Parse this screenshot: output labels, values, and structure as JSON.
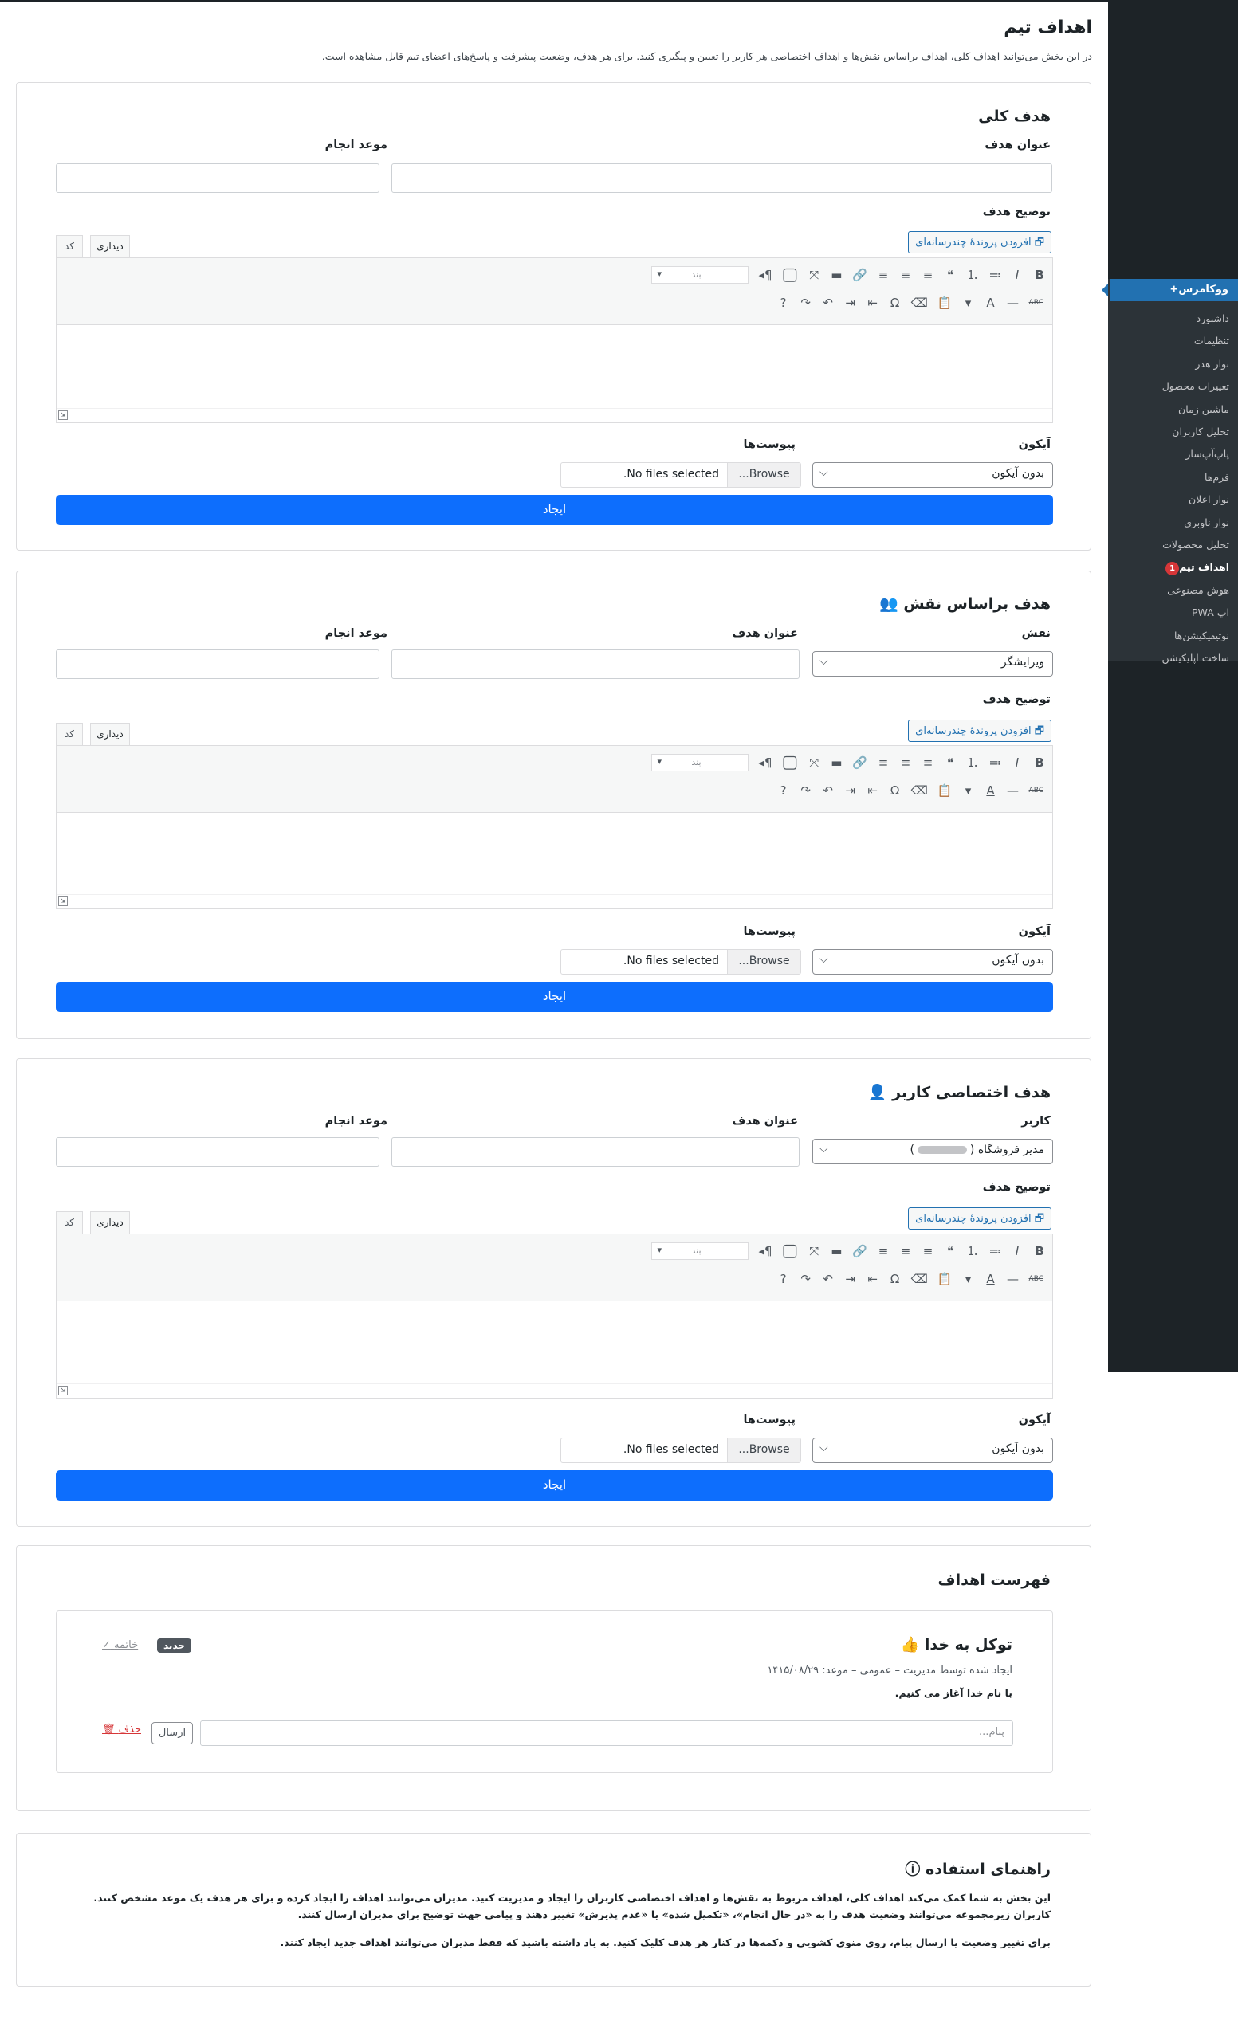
{
  "page": {
    "title": "اهداف تیم",
    "description": "در این بخش می‌توانید اهداف کلی، اهداف براساس نقش‌ها و اهداف اختصاصی هر کاربر را تعیین و پیگیری کنید. برای هر هدف، وضعیت پیشرفت و پاسخ‌های اعضای تیم قابل مشاهده است."
  },
  "sidebar": {
    "menu_title": "ووکامرس+",
    "items": [
      {
        "label": "داشبورد"
      },
      {
        "label": "تنظیمات"
      },
      {
        "label": "نوار هدر"
      },
      {
        "label": "تغییرات محصول"
      },
      {
        "label": "ماشین زمان"
      },
      {
        "label": "تحلیل کاربران"
      },
      {
        "label": "پاپ‌آپ‌ساز"
      },
      {
        "label": "فرم‌ها"
      },
      {
        "label": "نوار اعلان"
      },
      {
        "label": "نوار ناوبری"
      },
      {
        "label": "تحلیل محصولات"
      },
      {
        "label": "اهداف تیم",
        "badge": "1",
        "current": true
      },
      {
        "label": "هوش مصنوعی"
      },
      {
        "label": "اپ PWA"
      },
      {
        "label": "نوتیفیکیشن‌ها"
      },
      {
        "label": "ساخت اپلیکیشن"
      }
    ]
  },
  "editor": {
    "add_media": "افزودن پروندهٔ چندرسانه‌ای",
    "tab_visual": "دیداری",
    "tab_code": "کد",
    "format_placeholder": "بند",
    "row1_icons": [
      "B",
      "I",
      "≔",
      "⒈",
      "❝",
      "≡",
      "≡",
      "≡",
      "🔗",
      "▬",
      "⤧",
      "▢",
      "¶◂"
    ],
    "row2_icons": [
      "ABC",
      "—",
      "A",
      "▾",
      "📋",
      "⌫",
      "Ω",
      "⇤",
      "⇥",
      "↶",
      "↷",
      "?"
    ]
  },
  "general_goal": {
    "heading": "هدف کلی",
    "title_label": "عنوان هدف",
    "deadline_label": "موعد انجام",
    "description_label": "توضیح هدف",
    "icon_label": "آیکون",
    "icon_value": "بدون آیکون",
    "attachments_label": "پیوست‌ها",
    "browse_label": "Browse...",
    "no_files": "No files selected.",
    "create_label": "ایجاد"
  },
  "role_goal": {
    "heading": "هدف براساس نقش",
    "role_label": "نقش",
    "role_value": "ویرایشگر",
    "title_label": "عنوان هدف",
    "deadline_label": "موعد انجام",
    "description_label": "توضیح هدف",
    "icon_label": "آیکون",
    "icon_value": "بدون آیکون",
    "attachments_label": "پیوست‌ها",
    "browse_label": "Browse...",
    "no_files": "No files selected.",
    "create_label": "ایجاد"
  },
  "user_goal": {
    "heading": "هدف اختصاصی کاربر",
    "user_label": "کاربر",
    "user_value": "مدیر فروشگاه (",
    "title_label": "عنوان هدف",
    "deadline_label": "موعد انجام",
    "description_label": "توضیح هدف",
    "icon_label": "آیکون",
    "icon_value": "بدون آیکون",
    "attachments_label": "پیوست‌ها",
    "browse_label": "Browse...",
    "no_files": "No files selected.",
    "create_label": "ایجاد"
  },
  "goals_list": {
    "heading": "فهرست اهداف",
    "items": [
      {
        "title": "توکل به خدا",
        "meta": "ایجاد شده توسط مدیریت – عمومی – موعد: ۱۴۱۵/۰۸/۲۹",
        "body": "با نام خدا آغاز می کنیم.",
        "badge": "جدید",
        "finish_label": "خاتمه",
        "message_placeholder": "پیام...",
        "send_label": "ارسال",
        "delete_label": "حذف"
      }
    ]
  },
  "help": {
    "heading": "راهنمای استفاده",
    "paragraph1": "این بخش به شما کمک می‌کند اهداف کلی، اهداف مربوط به نقش‌ها و اهداف اختصاصی کاربران را ایجاد و مدیریت کنید. مدیران می‌توانند اهداف را ایجاد کرده و برای هر هدف یک موعد مشخص کنند. کاربران زیرمجموعه می‌توانند وضعیت هدف را به «در حال انجام»، «تکمیل شده» یا «عدم پذیرش» تغییر دهند و پیامی جهت توضیح برای مدیران ارسال کنند.",
    "paragraph2": "برای تغییر وضعیت یا ارسال پیام، روی منوی کشویی و دکمه‌ها در کنار هر هدف کلیک کنید. به یاد داشته باشید که فقط مدیران می‌توانند اهداف جدید ایجاد کنند."
  }
}
